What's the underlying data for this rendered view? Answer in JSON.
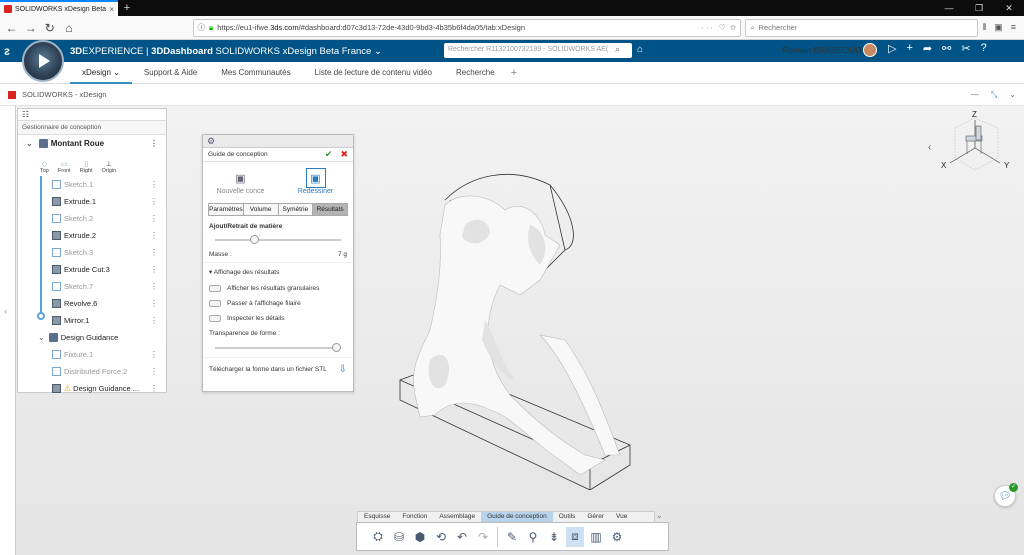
{
  "browser": {
    "tab_title": "SOLIDWORKS xDesign Beta Fra...",
    "url_prefix": "https://eu1-ifwe.",
    "url_domain": "3ds.com",
    "url_suffix": "/#dashboard:d07c3d13-72de-43d0-9bd3-4b35b6f4da05/tab:xDesign",
    "url_extras": "···",
    "search_placeholder": "Rechercher"
  },
  "app": {
    "brand_bold": "3D",
    "brand_rest": "EXPERIENCE | ",
    "dashboard_bold": "3DDashboard",
    "dashboard_rest": " SOLIDWORKS xDesign Beta France",
    "search_placeholder": "Rechercher R1132100732199 - SOLIDWORKS AE(",
    "user": "Romain BRASSOUD"
  },
  "dash_tabs": [
    "xDesign",
    "Support & Aide",
    "Mes Communautés",
    "Liste de lecture de contenu vidéo",
    "Recherche"
  ],
  "widget": {
    "title": "SOLIDWORKS - xDesign"
  },
  "tree": {
    "header": "Gestionnaire de conception",
    "root": "Montant Roue",
    "planes": [
      "Top",
      "Front",
      "Right",
      "Origin"
    ],
    "items": [
      {
        "label": "Sketch.1",
        "type": "sk"
      },
      {
        "label": "Extrude.1",
        "type": "feat"
      },
      {
        "label": "Sketch.2",
        "type": "sk"
      },
      {
        "label": "Extrude.2",
        "type": "feat"
      },
      {
        "label": "Sketch.3",
        "type": "sk"
      },
      {
        "label": "Extrude Cut.3",
        "type": "feat"
      },
      {
        "label": "Sketch.7",
        "type": "sk"
      },
      {
        "label": "Revolve.6",
        "type": "feat"
      },
      {
        "label": "Mirror.1",
        "type": "feat"
      }
    ],
    "guidance": "Design Guidance",
    "guidance_items": [
      "Fixture.1",
      "Distributed Force.2"
    ],
    "guidance_result": "Design Guidance ..."
  },
  "panel": {
    "title": "Guide de conception",
    "mode_new": "Nouvelle conce",
    "mode_redraw": "Redessiner",
    "tabs": [
      "Paramètres",
      "Volume",
      "Symétrie",
      "Résultats"
    ],
    "section": "Ajout/Retrait de matière",
    "mass_label": "Masse :",
    "mass_value": "7 g",
    "results_display": "Affichage des résultats",
    "check1": "Afficher les résultats granulaires",
    "check2": "Passer à l'affichage filaire",
    "check3": "Inspecter les détails",
    "transparency": "Transparence de forme :",
    "download": "Télécharger la forme dans un fichier STL",
    "material_slider": 0.3,
    "transparency_slider": 1.0
  },
  "viewcube": {
    "z": "Z",
    "x": "X",
    "y": "Y"
  },
  "actionbar": {
    "tabs": [
      "Esquisse",
      "Fonction",
      "Assemblage",
      "Guide de conception",
      "Outils",
      "Gérer",
      "Vue"
    ]
  },
  "icons": {
    "back": "arrow-left",
    "forward": "arrow-right",
    "reload": "reload",
    "home": "home",
    "lock": "lock",
    "search": "magnifier",
    "ok": "check",
    "cancel": "x"
  },
  "colors": {
    "appbar": "#005386",
    "accent": "#368ec4",
    "active_tab": "#b8d4ec"
  }
}
